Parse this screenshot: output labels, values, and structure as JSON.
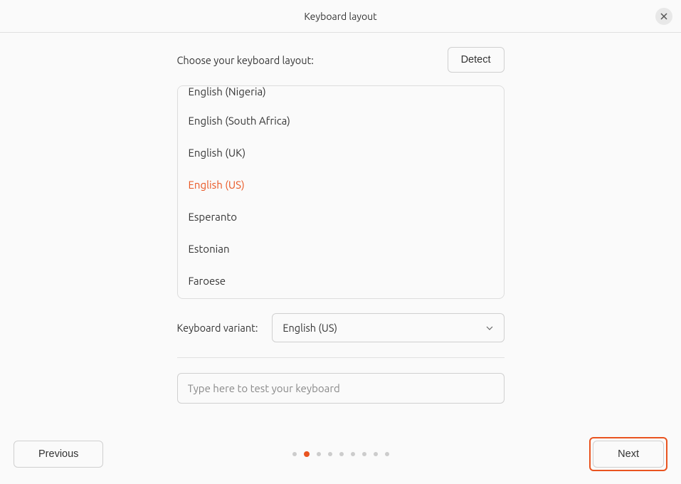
{
  "header": {
    "title": "Keyboard layout"
  },
  "prompt": "Choose your keyboard layout:",
  "detect_label": "Detect",
  "layouts": [
    "English (Nigeria)",
    "English (South Africa)",
    "English (UK)",
    "English (US)",
    "Esperanto",
    "Estonian",
    "Faroese"
  ],
  "selected_layout_index": 3,
  "variant": {
    "label": "Keyboard variant:",
    "value": "English (US)"
  },
  "test_input": {
    "placeholder": "Type here to test your keyboard"
  },
  "footer": {
    "previous": "Previous",
    "next": "Next"
  },
  "progress": {
    "total": 9,
    "active": 1
  }
}
